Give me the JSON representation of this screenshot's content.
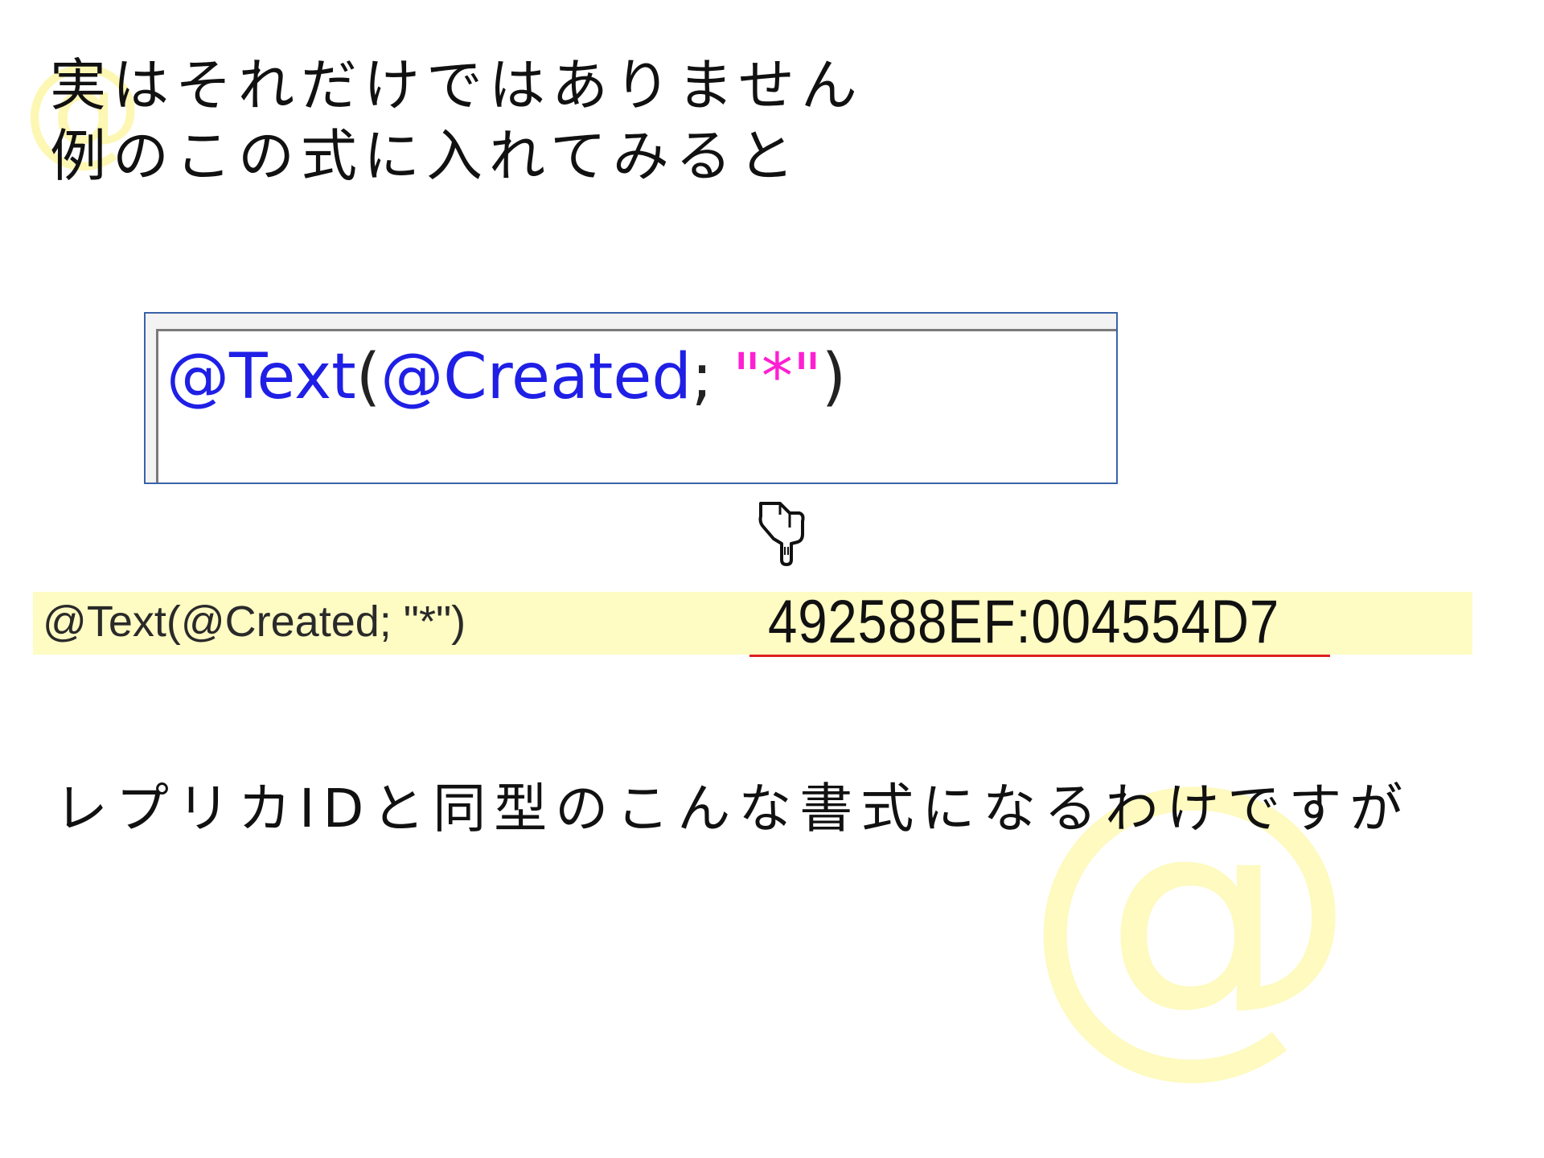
{
  "intro": {
    "line1": "実はそれだけではありません",
    "line2": "例のこの式に入れてみると"
  },
  "formula_box": {
    "fn_text": "@Text",
    "paren_open": "(",
    "fn_created": "@Created",
    "separator": "; ",
    "string_literal": "\"*\"",
    "paren_close": ")"
  },
  "result": {
    "formula": "@Text(@Created; \"*\")",
    "value": "492588EF:004554D7"
  },
  "conclusion": "レプリカIDと同型のこんな書式になるわけですが",
  "decorations": {
    "watermark_glyph": "@",
    "pointer_icon": "pointing-hand-down-icon"
  },
  "colors": {
    "function_blue": "#1f1fe6",
    "string_magenta": "#ff1fd2",
    "highlight_yellow": "#fefbc3",
    "underline_red": "#e02020",
    "box_border_blue": "#3a62a8"
  }
}
